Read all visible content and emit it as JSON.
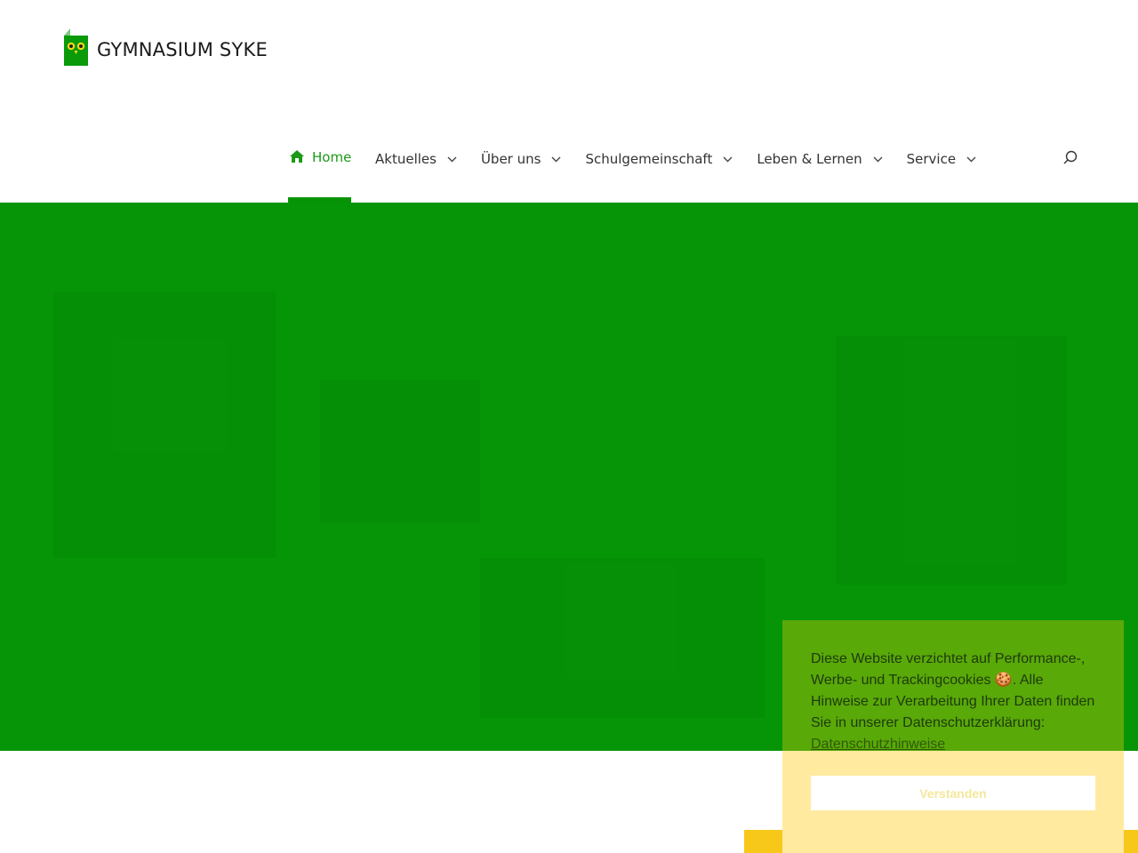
{
  "logo": {
    "text": "GYMNASIUM SYKE"
  },
  "nav": {
    "home": "Home",
    "items": [
      {
        "label": "Aktuelles"
      },
      {
        "label": "Über uns"
      },
      {
        "label": "Schulgemeinschaft"
      },
      {
        "label": "Leben & Lernen"
      },
      {
        "label": "Service"
      }
    ]
  },
  "colors": {
    "brand_green": "#069507",
    "active_nav": "#1b9a18",
    "cookie_bg": "#60aa0a",
    "accent_yellow": "#f7c81a"
  },
  "icons": {
    "home": "home-icon",
    "chevron": "chevron-down-icon",
    "search": "search-icon",
    "logo": "owl-logo-icon"
  },
  "cookie": {
    "text_part1": "Diese Website verzichtet auf Performance-, Werbe- und Trackingcookies ",
    "emoji": "🍪",
    "text_part2": ". Alle Hinweise zur Verarbeitung Ihrer Daten finden Sie in unserer Datenschutzerklärung: ",
    "link": "Datenschutzhinweise",
    "button": "Verstanden"
  }
}
